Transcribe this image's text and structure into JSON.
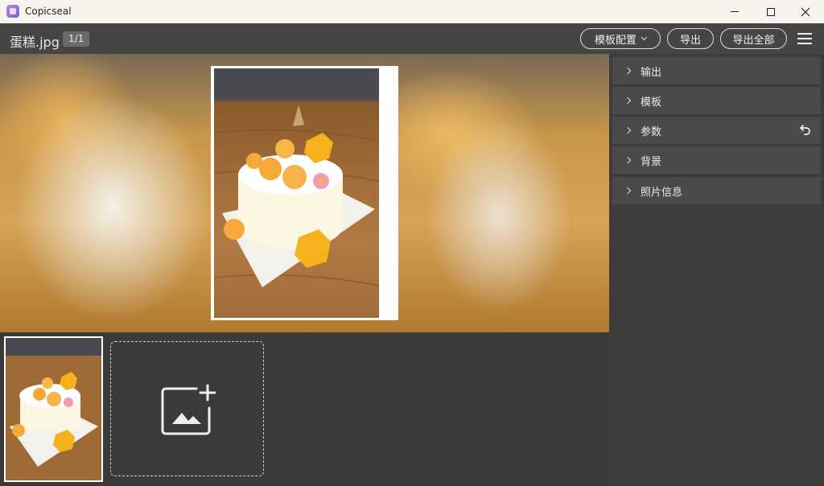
{
  "window": {
    "title": "Copicseal"
  },
  "toolbar": {
    "filename": "蛋糕.jpg",
    "page_indicator": "1/1",
    "template_config_label": "模板配置",
    "export_label": "导出",
    "export_all_label": "导出全部",
    "menu_icon": "hamburger-icon"
  },
  "sidebar": {
    "sections": [
      {
        "label": "输出",
        "icon": "chevron-right-icon"
      },
      {
        "label": "模板",
        "icon": "chevron-right-icon"
      },
      {
        "label": "参数",
        "icon": "chevron-right-icon",
        "action_icon": "undo-icon"
      },
      {
        "label": "背景",
        "icon": "chevron-right-icon"
      },
      {
        "label": "照片信息",
        "icon": "chevron-right-icon"
      }
    ]
  },
  "thumbnails": {
    "add_icon": "add-image-icon"
  },
  "colors": {
    "titlebar": "#f7f4ee",
    "toolbar": "#454545",
    "panel": "#4a4a4a",
    "background": "#3a3a3a"
  }
}
